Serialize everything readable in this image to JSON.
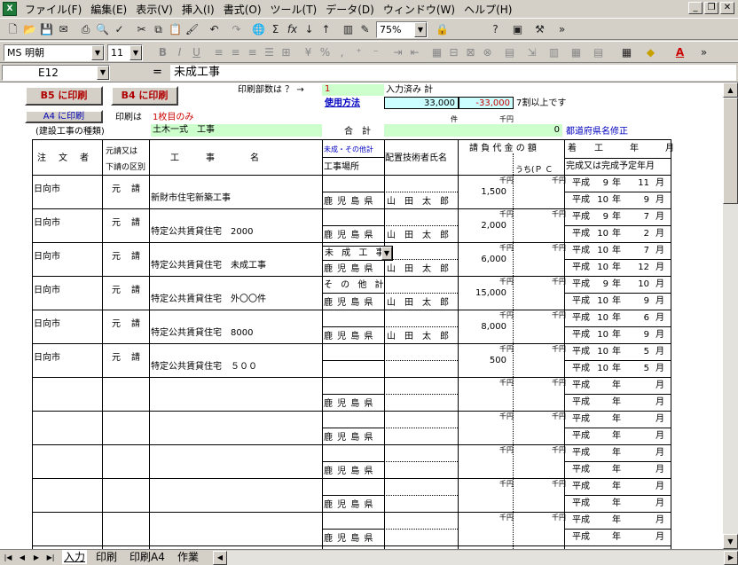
{
  "menu": {
    "items": [
      "ファイル(F)",
      "編集(E)",
      "表示(V)",
      "挿入(I)",
      "書式(O)",
      "ツール(T)",
      "データ(D)",
      "ウィンドウ(W)",
      "ヘルプ(H)"
    ]
  },
  "toolbar": {
    "zoom": "75%",
    "font": "MS 明朝",
    "size": "11"
  },
  "formula": {
    "cell": "E12",
    "fx": "=",
    "content": "未成工事"
  },
  "buttons": {
    "b5": "B5 に印刷",
    "b4": "B4 に印刷",
    "a4": "A4 に印刷"
  },
  "header": {
    "print_copies_label": "印刷部数は ？ →",
    "print_copies_value": "1",
    "entered_total_label": "入力済み 計",
    "usage_method": "使用方法",
    "val1": "33,000",
    "val2": "-33,000",
    "note": "7割以上です",
    "print_note_label": "印刷は",
    "print_note_value": "1枚目のみ",
    "unit_ken": "件",
    "unit_senen": "千円",
    "kind_label": "(建設工事の種類)",
    "kind_value": "土木一式　工事",
    "gokei": "合　計",
    "gokei_val": "0",
    "pref_fix": "都道府県名修正"
  },
  "columns": {
    "client": "注　文　者",
    "motouke_1": "元請又は",
    "motouke_2": "下請の区別",
    "koji": "工　　　事　　　　名",
    "place_top": "未成・その他計",
    "place": "工事場所",
    "engineer": "配置技術者氏名",
    "amount": "請 負 代 金 の 額",
    "amount_sub": "うち(Ｐ Ｃ",
    "period_top": "着　　工　　　年　　　月",
    "period_bot": "完成又は完成予定年月"
  },
  "rows": [
    {
      "client": "日向市",
      "type": "元　請",
      "name": "新財市住宅新築工事",
      "tag": "",
      "place": "鹿 児 島 県",
      "eng": "山　田　太　郎",
      "amount": "1,500",
      "s_era": "平成",
      "s_y": "9",
      "s_m": "11",
      "e_era": "平成",
      "e_y": "10",
      "e_m": "9"
    },
    {
      "client": "日向市",
      "type": "元　請",
      "name": "特定公共賃貸住宅　2000",
      "tag": "",
      "place": "鹿 児 島 県",
      "eng": "山　田　太　郎",
      "amount": "2,000",
      "s_era": "平成",
      "s_y": "9",
      "s_m": "7",
      "e_era": "平成",
      "e_y": "10",
      "e_m": "2"
    },
    {
      "client": "日向市",
      "type": "元　請",
      "name": "特定公共賃貸住宅　未成工事",
      "tag": "未 成 工 事",
      "place": "鹿 児 島 県",
      "eng": "山　田　太　郎",
      "amount": "6,000",
      "s_era": "平成",
      "s_y": "10",
      "s_m": "7",
      "e_era": "平成",
      "e_y": "10",
      "e_m": "12"
    },
    {
      "client": "日向市",
      "type": "元　請",
      "name": "特定公共賃貸住宅　外〇〇件",
      "tag": "そ の 他 計",
      "place": "鹿 児 島 県",
      "eng": "山　田　太　郎",
      "amount": "15,000",
      "s_era": "平成",
      "s_y": "9",
      "s_m": "10",
      "e_era": "平成",
      "e_y": "10",
      "e_m": "9"
    },
    {
      "client": "日向市",
      "type": "元　請",
      "name": "特定公共賃貸住宅　8000",
      "tag": "",
      "place": "鹿 児 島 県",
      "eng": "山　田　太　郎",
      "amount": "8,000",
      "s_era": "平成",
      "s_y": "10",
      "s_m": "6",
      "e_era": "平成",
      "e_y": "10",
      "e_m": "9"
    },
    {
      "client": "日向市",
      "type": "元　請",
      "name": "特定公共賃貸住宅　５００",
      "tag": "",
      "place": "",
      "eng": "",
      "amount": "500",
      "s_era": "平成",
      "s_y": "10",
      "s_m": "5",
      "e_era": "平成",
      "e_y": "10",
      "e_m": "5"
    },
    {
      "client": "",
      "type": "",
      "name": "",
      "tag": "",
      "place": "鹿 児 島 県",
      "eng": "",
      "amount": "",
      "s_era": "平成",
      "s_y": "",
      "s_m": "",
      "e_era": "平成",
      "e_y": "",
      "e_m": ""
    },
    {
      "client": "",
      "type": "",
      "name": "",
      "tag": "",
      "place": "鹿 児 島 県",
      "eng": "",
      "amount": "",
      "s_era": "平成",
      "s_y": "",
      "s_m": "",
      "e_era": "平成",
      "e_y": "",
      "e_m": ""
    },
    {
      "client": "",
      "type": "",
      "name": "",
      "tag": "",
      "place": "鹿 児 島 県",
      "eng": "",
      "amount": "",
      "s_era": "平成",
      "s_y": "",
      "s_m": "",
      "e_era": "平成",
      "e_y": "",
      "e_m": ""
    },
    {
      "client": "",
      "type": "",
      "name": "",
      "tag": "",
      "place": "鹿 児 島 県",
      "eng": "",
      "amount": "",
      "s_era": "平成",
      "s_y": "",
      "s_m": "",
      "e_era": "平成",
      "e_y": "",
      "e_m": ""
    },
    {
      "client": "",
      "type": "",
      "name": "",
      "tag": "",
      "place": "鹿 児 島 県",
      "eng": "",
      "amount": "",
      "s_era": "平成",
      "s_y": "",
      "s_m": "",
      "e_era": "平成",
      "e_y": "",
      "e_m": ""
    }
  ],
  "units": {
    "nen": "年",
    "tsuki": "月",
    "senen": "千円"
  },
  "tabs": [
    "入力",
    "印刷",
    "印刷A4",
    "作業"
  ]
}
